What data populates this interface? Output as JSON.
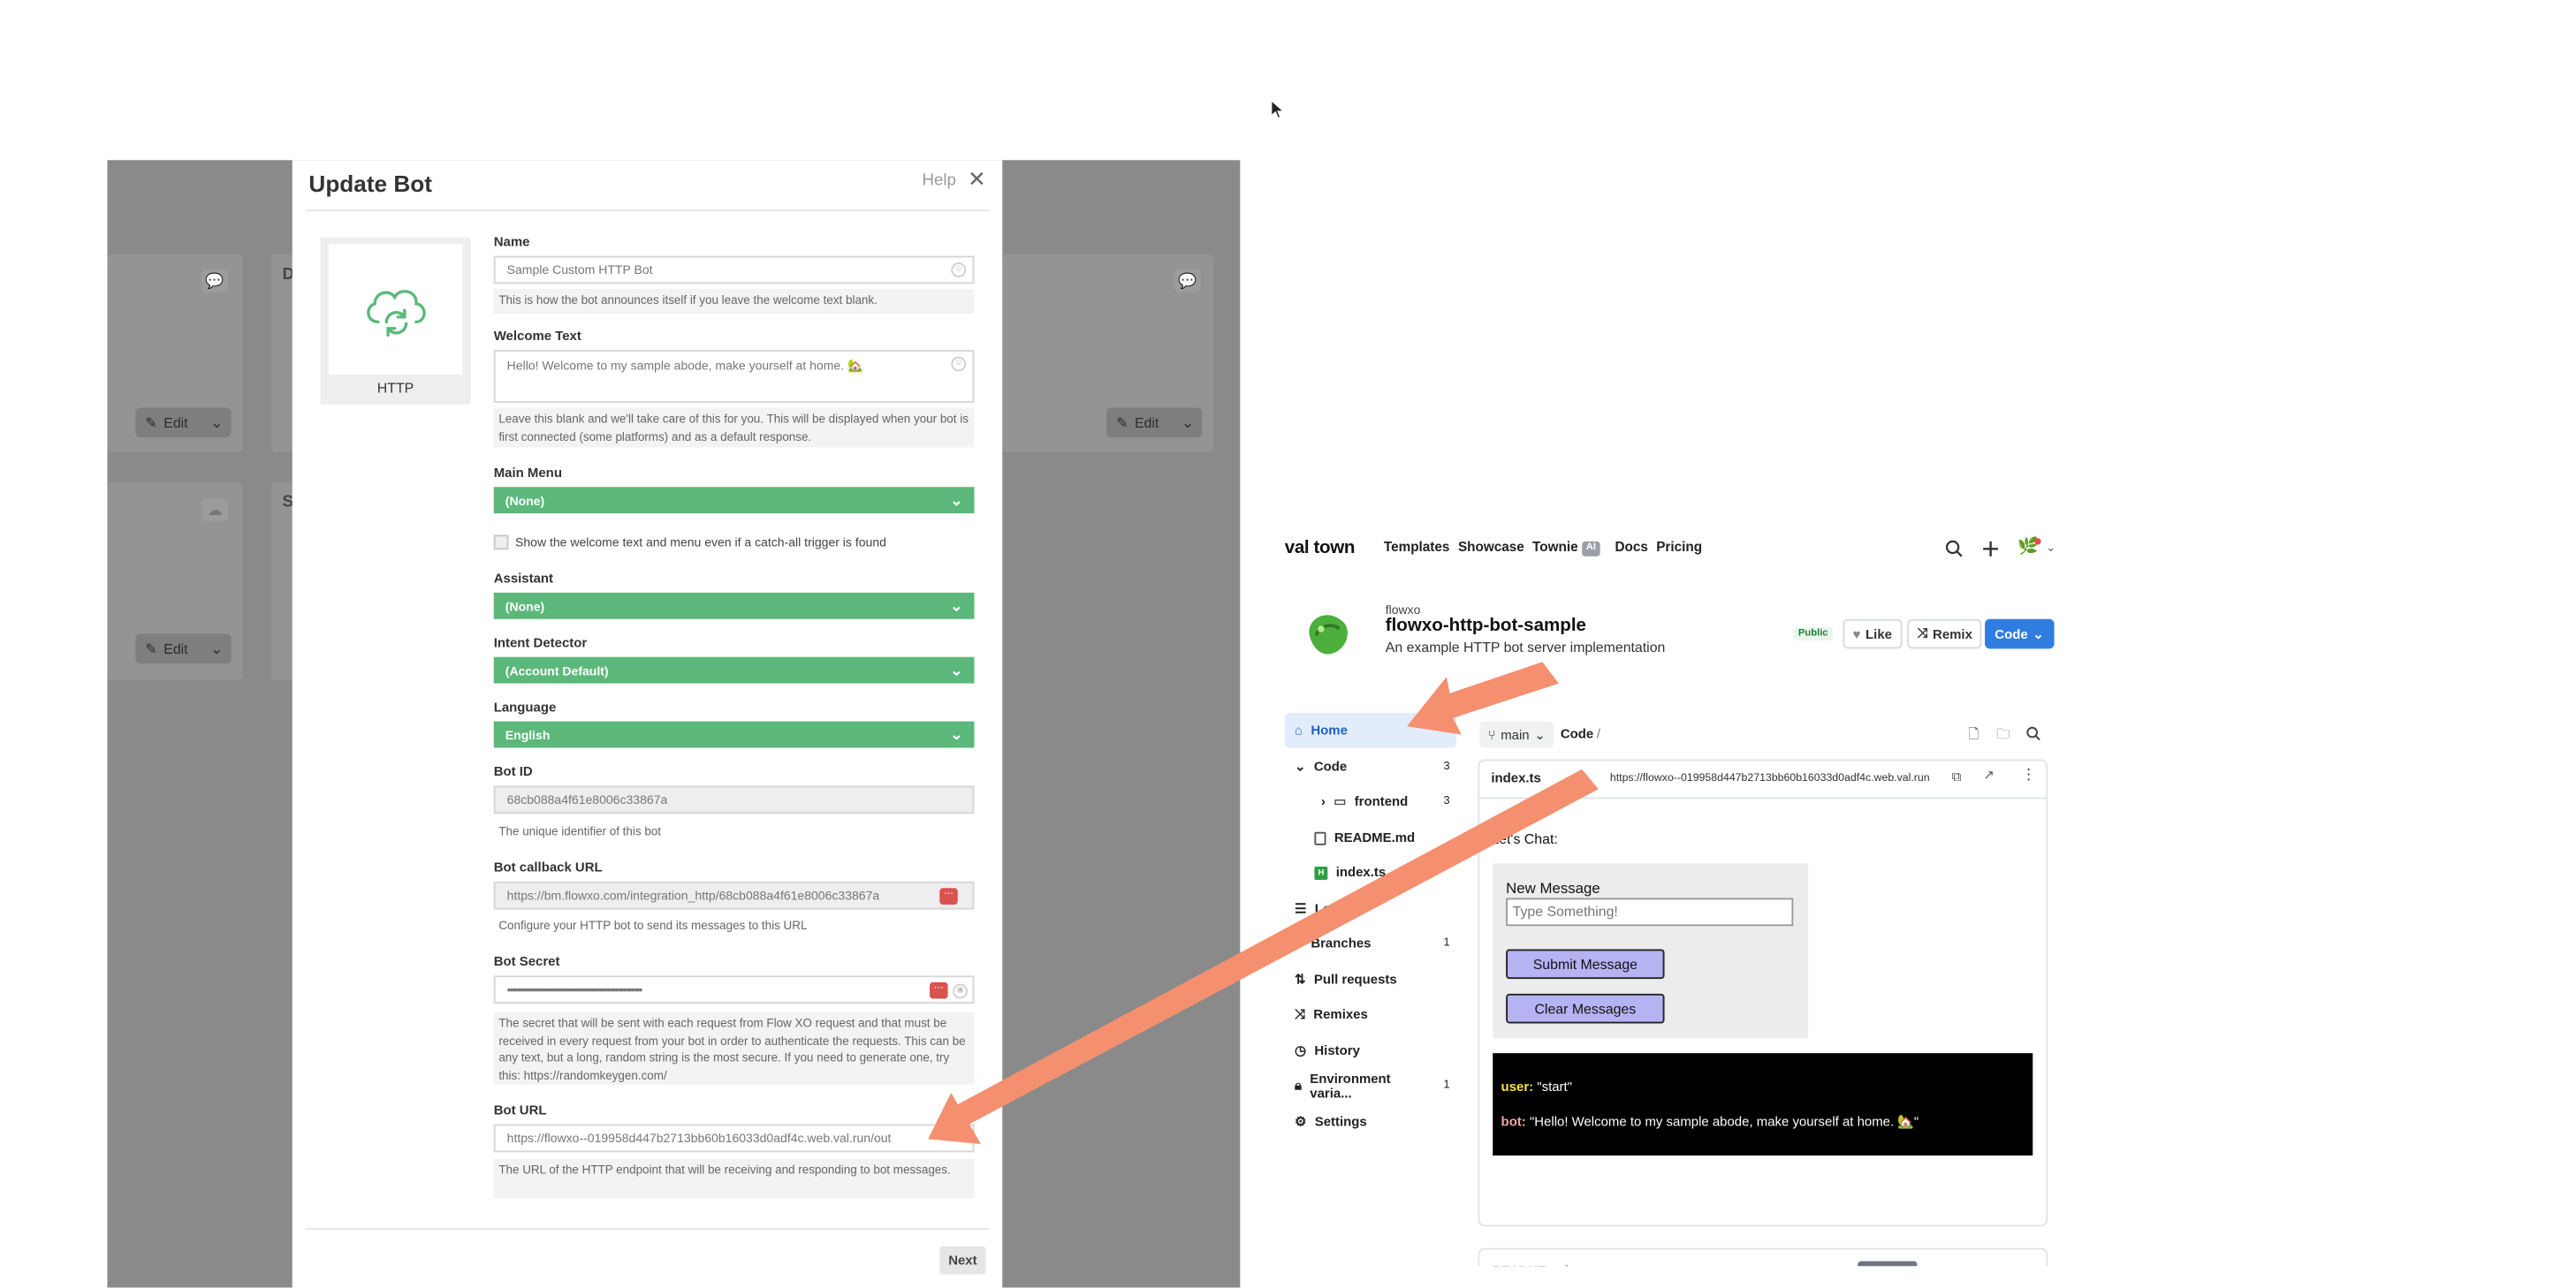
{
  "overlay_app": {
    "edit_label": "Edit",
    "card_letters": [
      "D",
      "S"
    ]
  },
  "modal": {
    "title": "Update Bot",
    "help": "Help",
    "close_icon": "close-icon",
    "bot_type": "HTTP",
    "fields": {
      "name_label": "Name",
      "name_value": "Sample Custom HTTP Bot",
      "name_help": "This is how the bot announces itself if you leave the welcome text blank.",
      "welcome_label": "Welcome Text",
      "welcome_value": "Hello! Welcome to my sample abode, make yourself at home. 🏡",
      "welcome_help": "Leave this blank and we'll take care of this for you. This will be displayed when your bot is first connected (some platforms) and as a default response.",
      "main_menu_label": "Main Menu",
      "main_menu_value": "(None)",
      "catchall_label": "Show the welcome text and menu even if a catch-all trigger is found",
      "assistant_label": "Assistant",
      "assistant_value": "(None)",
      "intent_label": "Intent Detector",
      "intent_value": "(Account Default)",
      "language_label": "Language",
      "language_value": "English",
      "bot_id_label": "Bot ID",
      "bot_id_value": "68cb088a4f61e8006c33867a",
      "bot_id_help": "The unique identifier of this bot",
      "callback_label": "Bot callback URL",
      "callback_value": "https://bm.flowxo.com/integration_http/68cb088a4f61e8006c33867a",
      "callback_help": "Configure your HTTP bot to send its messages to this URL",
      "secret_label": "Bot Secret",
      "secret_value": "••••••••••••••••••••••••••••••••••••••••••••••••••",
      "secret_help": "The secret that will be sent with each request from Flow XO request and that must be received in every request from your bot in order to authenticate the requests. This can be any text, but a long, random string is the most secure. If you need to generate one, try this: https://randomkeygen.com/",
      "bot_url_label": "Bot URL",
      "bot_url_value": "https://flowxo--019958d447b2713bb60b16033d0adf4c.web.val.run/out",
      "bot_url_help": "The URL of the HTTP endpoint that will be receiving and responding to bot messages."
    },
    "next": "Next"
  },
  "valtown": {
    "logo": "val town",
    "nav": [
      "Templates",
      "Showcase",
      "Townie",
      "Docs",
      "Pricing"
    ],
    "ai_badge": "AI",
    "owner": "flowxo",
    "project_name": "flowxo-http-bot-sample",
    "description": "An example HTTP bot server implementation",
    "visibility": "Public",
    "like": "Like",
    "remix": "Remix",
    "code": "Code",
    "branch": "main",
    "breadcrumb": "Code",
    "breadcrumb_sep": "/",
    "sidebar": [
      {
        "label": "Home",
        "count": ""
      },
      {
        "label": "Code",
        "count": "3"
      },
      {
        "label": "frontend",
        "count": "3"
      },
      {
        "label": "README.md",
        "count": ""
      },
      {
        "label": "index.ts",
        "count": ""
      },
      {
        "label": "Logs",
        "count": ""
      },
      {
        "label": "Branches",
        "count": "1"
      },
      {
        "label": "Pull requests",
        "count": ""
      },
      {
        "label": "Remixes",
        "count": ""
      },
      {
        "label": "History",
        "count": ""
      },
      {
        "label": "Environment varia...",
        "count": "1"
      },
      {
        "label": "Settings",
        "count": ""
      }
    ],
    "file_name": "index.ts",
    "file_url": "https://flowxo--019958d447b2713bb60b16033d0adf4c.web.val.run",
    "preview": {
      "heading": "Let's Chat:",
      "new_message_label": "New Message",
      "input_placeholder": "Type Something!",
      "submit": "Submit Message",
      "clear": "Clear Messages",
      "log": [
        {
          "who": "user:",
          "text": "\"start\""
        },
        {
          "who": "bot:",
          "text": "\"Hello! Welcome to my sample abode, make yourself at home. 🏡\""
        }
      ]
    },
    "readme_peek": "README.md"
  },
  "colors": {
    "accent_green": "#5cb87a",
    "arrow": "#f4906f",
    "valtown_blue": "#2f7de1"
  }
}
